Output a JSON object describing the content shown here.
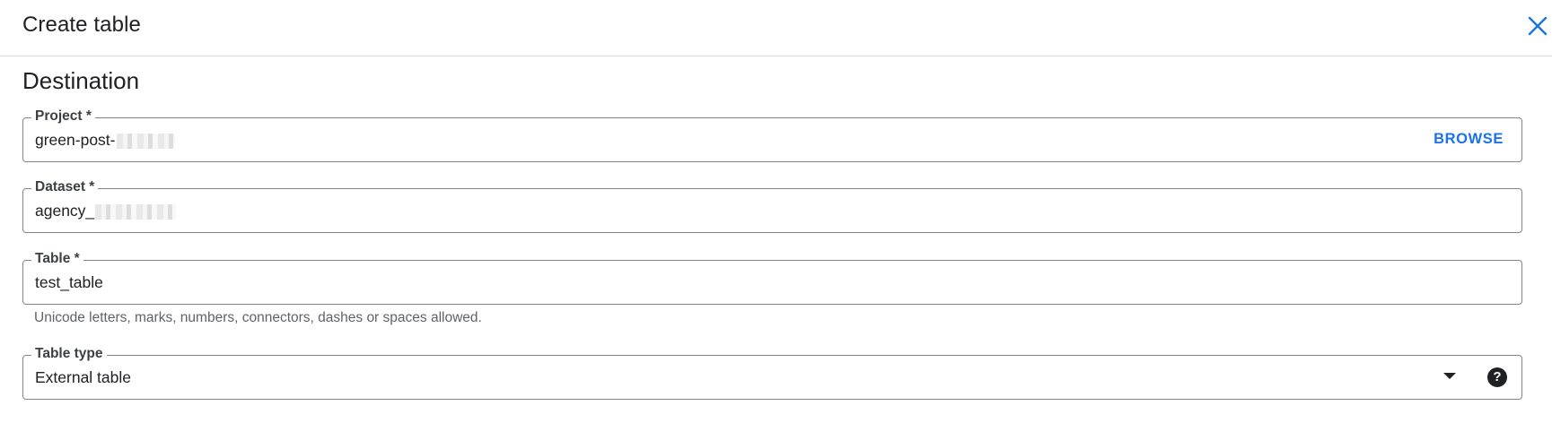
{
  "dialog": {
    "title": "Create table",
    "close_icon": "close-icon"
  },
  "destination": {
    "heading": "Destination",
    "project": {
      "label": "Project *",
      "value": "green-post-",
      "browse_label": "BROWSE"
    },
    "dataset": {
      "label": "Dataset *",
      "value": "agency_"
    },
    "table": {
      "label": "Table *",
      "value": "test_table",
      "helper": "Unicode letters, marks, numbers, connectors, dashes or spaces allowed."
    },
    "table_type": {
      "label": "Table type",
      "value": "External table",
      "dropdown_icon": "arrow-drop-down-icon",
      "help_icon": "help-icon"
    }
  },
  "colors": {
    "accent": "#1a73e8",
    "text": "#202124",
    "border": "#80868b",
    "helper": "#5f6368"
  }
}
